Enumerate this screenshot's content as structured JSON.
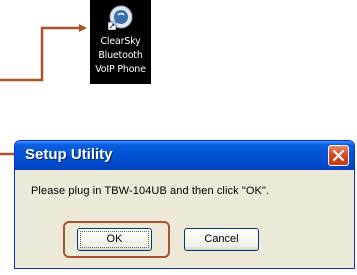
{
  "desktop": {
    "shortcut": {
      "icon": "clearsky-app-icon",
      "label_lines": [
        "ClearSky",
        "Bluetooth",
        "VoIP Phone"
      ]
    }
  },
  "dialog": {
    "title": "Setup Utility",
    "message": "Please plug in TBW-104UB and then click \"OK\".",
    "ok_label": "OK",
    "cancel_label": "Cancel"
  },
  "colors": {
    "annotation": "#a9532a",
    "titlebar": "#0153d6",
    "dialog_bg": "#ece9d8"
  }
}
